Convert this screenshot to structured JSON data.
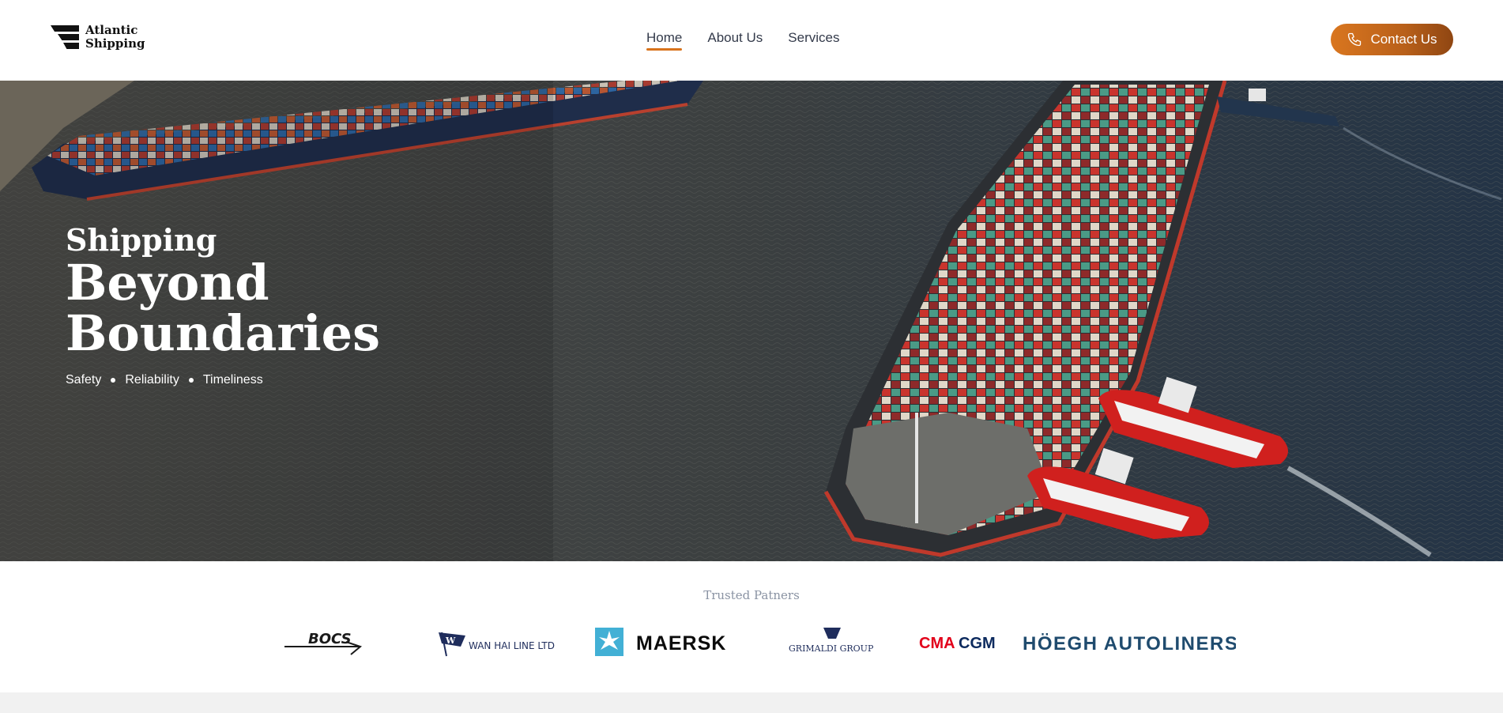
{
  "brand": {
    "line1": "Atlantic",
    "line2": "Shipping"
  },
  "nav": {
    "items": [
      {
        "label": "Home",
        "active": true
      },
      {
        "label": "About Us",
        "active": false
      },
      {
        "label": "Services",
        "active": false
      }
    ]
  },
  "contact": {
    "label": "Contact Us",
    "icon": "phone-icon"
  },
  "hero": {
    "kicker": "Shipping",
    "title_line1": "Beyond",
    "title_line2": "Boundaries",
    "tags": [
      "Safety",
      "Reliability",
      "Timeliness"
    ]
  },
  "partners": {
    "title": "Trusted Patners",
    "logos": {
      "bocs": "BOCS",
      "wanhai": "WAN HAI LINE LTD.",
      "maersk": "MAERSK",
      "grimaldi": "GRIMALDI GROUP",
      "cma": "CMA",
      "cgm": "CGM",
      "hoegh": "HÖEGH AUTOLINERS"
    }
  },
  "colors": {
    "accent": "#d8731c",
    "maersk": "#42b0d5",
    "cma": "#e2001a",
    "cgm": "#0c2a5e",
    "hoegh": "#1f4b6e"
  }
}
